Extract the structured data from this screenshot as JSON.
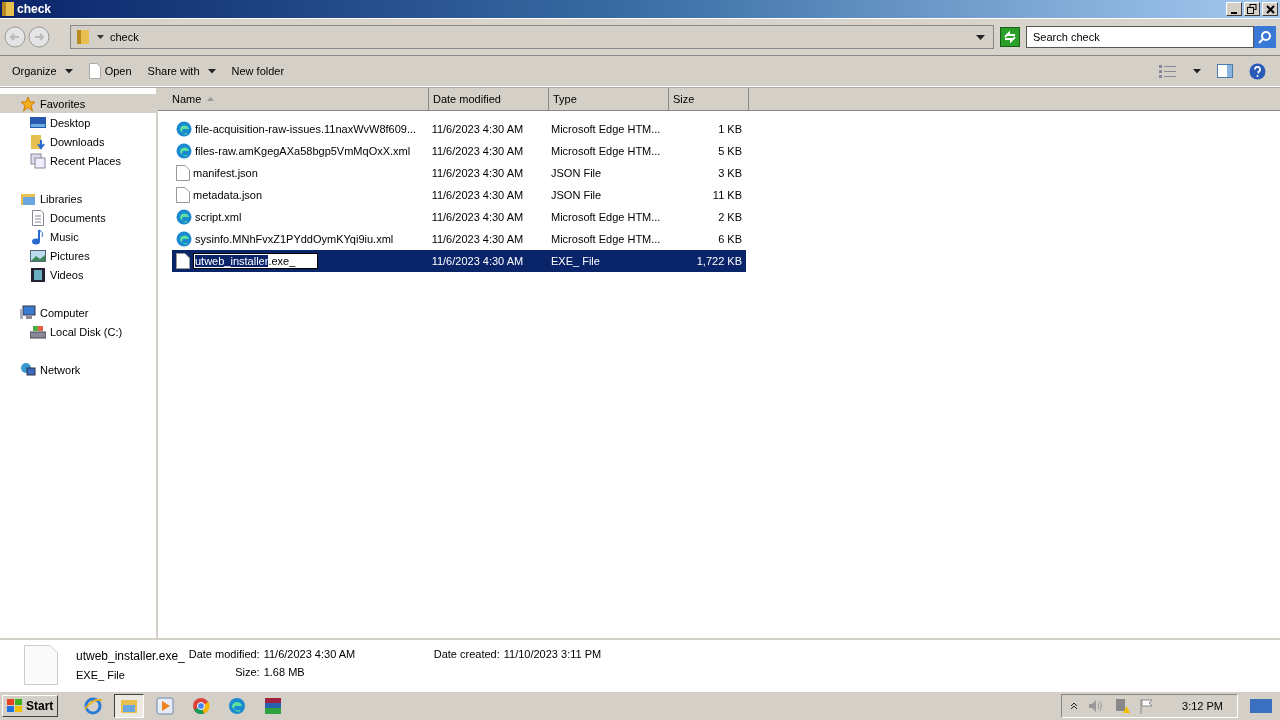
{
  "window": {
    "title": "check"
  },
  "address": {
    "path": "check"
  },
  "search": {
    "placeholder": "Search check"
  },
  "toolbar": [
    {
      "label": "Organize",
      "kind": "menu"
    },
    {
      "label": "Open",
      "kind": "icon"
    },
    {
      "label": "Share with",
      "kind": "menu"
    },
    {
      "label": "New folder",
      "kind": "plain"
    }
  ],
  "sidebar": [
    {
      "label": "Favorites",
      "kind": "star",
      "selected": true,
      "children": [
        {
          "label": "Desktop",
          "kind": "desktop",
          "selected": false
        },
        {
          "label": "Downloads",
          "kind": "download",
          "selected": false
        },
        {
          "label": "Recent Places",
          "kind": "recent",
          "selected": false
        }
      ]
    },
    {
      "label": "Libraries",
      "kind": "library",
      "selected": false,
      "children": [
        {
          "label": "Documents",
          "kind": "document",
          "selected": false
        },
        {
          "label": "Music",
          "kind": "music",
          "selected": false
        },
        {
          "label": "Pictures",
          "kind": "picture",
          "selected": false
        },
        {
          "label": "Videos",
          "kind": "video",
          "selected": false
        }
      ]
    },
    {
      "label": "Computer",
      "kind": "computer",
      "selected": false,
      "children": [
        {
          "label": "Local Disk (C:)",
          "kind": "disk",
          "selected": false
        }
      ]
    },
    {
      "label": "Network",
      "kind": "network",
      "selected": false
    }
  ],
  "table": {
    "columns": [
      {
        "label": "Name",
        "sorted": true
      },
      {
        "label": "Date modified",
        "sorted": false
      },
      {
        "label": "Type",
        "sorted": false
      },
      {
        "label": "Size",
        "sorted": false
      }
    ],
    "rows": [
      {
        "name": "file-acquisition-raw-issues.11naxWvW8f609...",
        "date": "11/6/2023 4:30 AM",
        "type": "Microsoft Edge HTM...",
        "size": "1 KB",
        "kind": "edge",
        "selected": false
      },
      {
        "name": "files-raw.amKgegAXa58bgp5VmMqOxX.xml",
        "date": "11/6/2023 4:30 AM",
        "type": "Microsoft Edge HTM...",
        "size": "5 KB",
        "kind": "edge",
        "selected": false
      },
      {
        "name": "manifest.json",
        "date": "11/6/2023 4:30 AM",
        "type": "JSON File",
        "size": "3 KB",
        "kind": "file",
        "selected": false
      },
      {
        "name": "metadata.json",
        "date": "11/6/2023 4:30 AM",
        "type": "JSON File",
        "size": "11 KB",
        "kind": "file",
        "selected": false
      },
      {
        "name": "script.xml",
        "date": "11/6/2023 4:30 AM",
        "type": "Microsoft Edge HTM...",
        "size": "2 KB",
        "kind": "edge",
        "selected": false
      },
      {
        "name": "sysinfo.MNhFvxZ1PYddOymKYqi9iu.xml",
        "date": "11/6/2023 4:30 AM",
        "type": "Microsoft Edge HTM...",
        "size": "6 KB",
        "kind": "edge",
        "selected": false
      },
      {
        "date": "11/6/2023 4:30 AM",
        "type": "EXE_ File",
        "size": "1,722 KB",
        "kind": "file",
        "selected": true,
        "rename": {
          "selected_text": "utweb_installer",
          "rest": ".exe_"
        }
      }
    ]
  },
  "details": {
    "name": "utweb_installer.exe_",
    "type": "EXE_ File",
    "fields": [
      {
        "label": "Date modified:",
        "value": "11/6/2023 4:30 AM"
      },
      {
        "label": "Date created:",
        "value": "11/10/2023 3:11 PM"
      },
      {
        "label": "Size:",
        "value": "1.68 MB"
      }
    ]
  },
  "taskbar": {
    "start": "Start",
    "apps": [
      {
        "kind": "ie",
        "selected": false
      },
      {
        "kind": "explorer",
        "selected": true
      },
      {
        "kind": "media",
        "selected": false
      },
      {
        "kind": "chrome",
        "selected": false
      },
      {
        "kind": "edge",
        "selected": false
      },
      {
        "kind": "archive",
        "selected": false
      }
    ],
    "clock": "3:12 PM"
  }
}
